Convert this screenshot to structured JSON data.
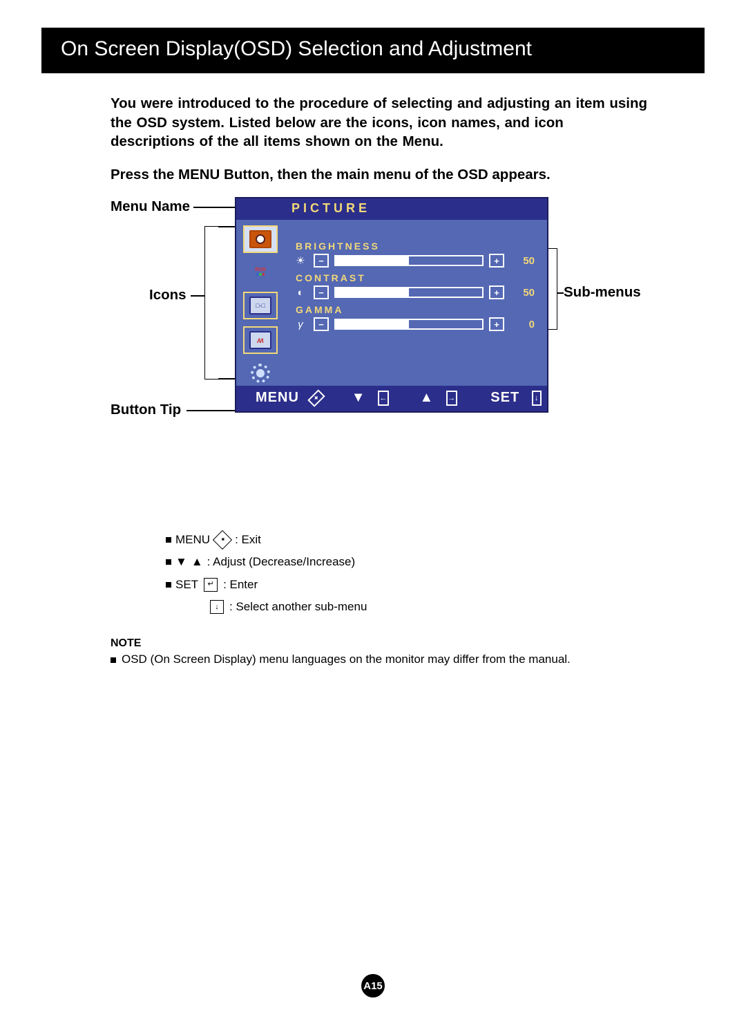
{
  "title": "On Screen Display(OSD) Selection and Adjustment",
  "intro": "You were introduced to the procedure of selecting and adjusting an item using the OSD system.  Listed below are the icons, icon names, and icon descriptions of the all items shown on the Menu.",
  "press": "Press the MENU Button, then the main menu of the OSD appears.",
  "labels": {
    "menu_name": "Menu Name",
    "icons": "Icons",
    "button_tip": "Button Tip",
    "sub_menus": "Sub-menus"
  },
  "osd": {
    "menu_name": "PICTURE",
    "settings": [
      {
        "title": "BRIGHTNESS",
        "icon": "brightness",
        "value": "50",
        "fill_pct": 50
      },
      {
        "title": "CONTRAST",
        "icon": "contrast",
        "value": "50",
        "fill_pct": 50
      },
      {
        "title": "GAMMA",
        "icon": "gamma",
        "value": "0",
        "fill_pct": 50
      }
    ],
    "footer": {
      "menu": "MENU",
      "set": "SET"
    }
  },
  "tips": {
    "menu_label": "MENU",
    "menu_desc": ": Exit",
    "adjust_desc": ": Adjust (Decrease/Increase)",
    "set_label": "SET",
    "set_desc": ": Enter",
    "select_desc": ": Select another sub-menu"
  },
  "note": {
    "title": "NOTE",
    "text": "OSD (On Screen Display) menu languages on the monitor may differ from the manual."
  },
  "page_number": "A15"
}
